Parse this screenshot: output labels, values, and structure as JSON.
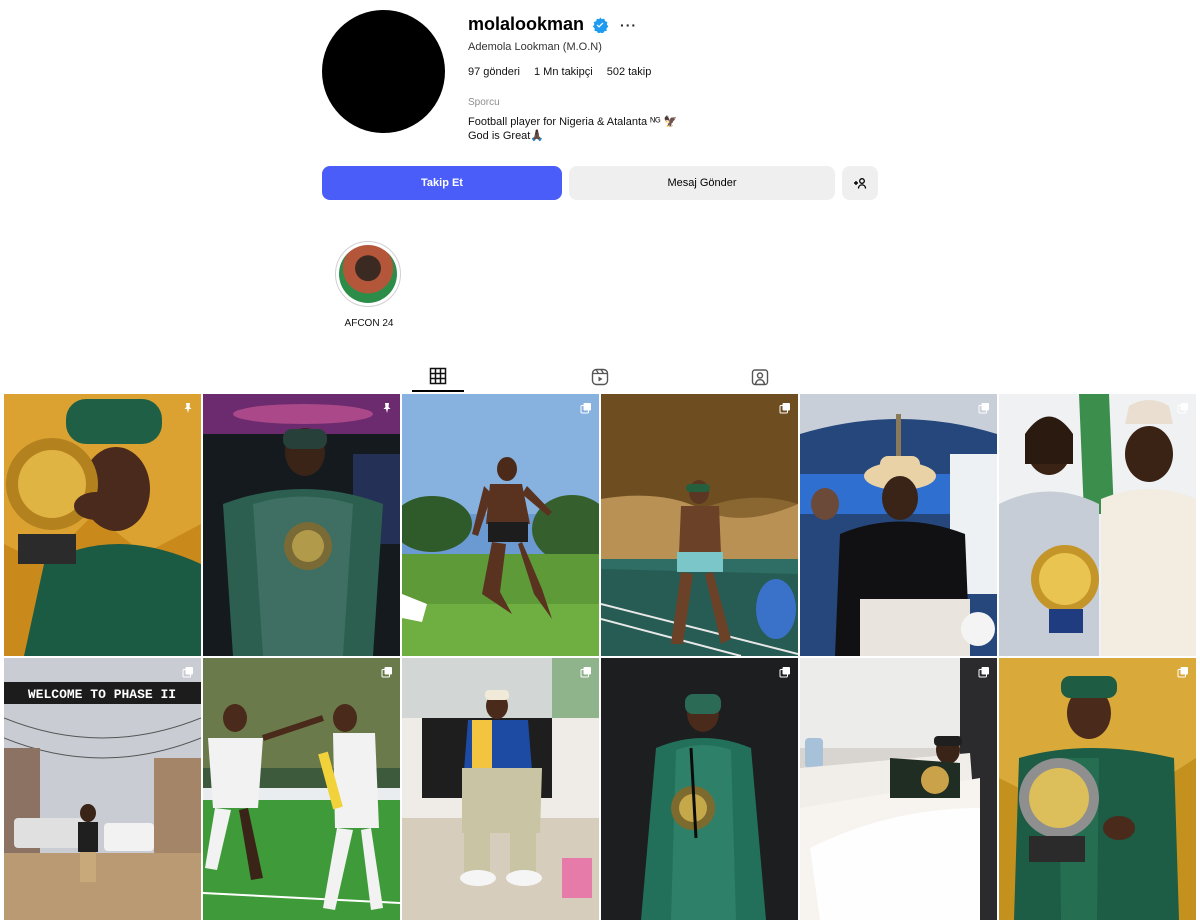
{
  "profile": {
    "username": "molalookman",
    "more": "···",
    "full_name": "Ademola Lookman (M.O.N)",
    "stats": {
      "posts": "97 gönderi",
      "followers": "1 Mn takipçi",
      "following": "502 takip"
    },
    "category": "Sporcu",
    "bio_line1": "Football player for Nigeria & Atalanta ᴺᴳ 🦅",
    "bio_line2": "God is Great🙏🏿"
  },
  "actions": {
    "follow_label": "Takip Et",
    "message_label": "Mesaj Gönder",
    "add_label": "+Α"
  },
  "highlights": [
    {
      "label": "AFCON 24"
    }
  ],
  "tabs": [
    {
      "name": "posts",
      "icon": "grid-icon",
      "active": true
    },
    {
      "name": "reels",
      "icon": "reels-icon",
      "active": false
    },
    {
      "name": "tagged",
      "icon": "tagged-icon",
      "active": false
    }
  ],
  "posts": [
    {
      "description_icon": "pin-icon"
    },
    {
      "description_icon": "pin-icon"
    },
    {
      "description_icon": "carousel-icon"
    },
    {
      "description_icon": "carousel-icon"
    },
    {
      "description_icon": "carousel-icon"
    },
    {
      "description_icon": "carousel-icon"
    },
    {
      "description_icon": "carousel-icon"
    },
    {
      "description_icon": "carousel-icon"
    },
    {
      "description_icon": "carousel-icon"
    },
    {
      "description_icon": "carousel-icon"
    },
    {
      "description_icon": "carousel-icon"
    },
    {
      "description_icon": "carousel-icon"
    }
  ],
  "post_overlay_text": {
    "post7": "WELCOME TO PHASE II"
  },
  "colors": {
    "follow_button": "#4a5df9",
    "verified": "#1d9bf0",
    "secondary_button": "#efefef"
  }
}
